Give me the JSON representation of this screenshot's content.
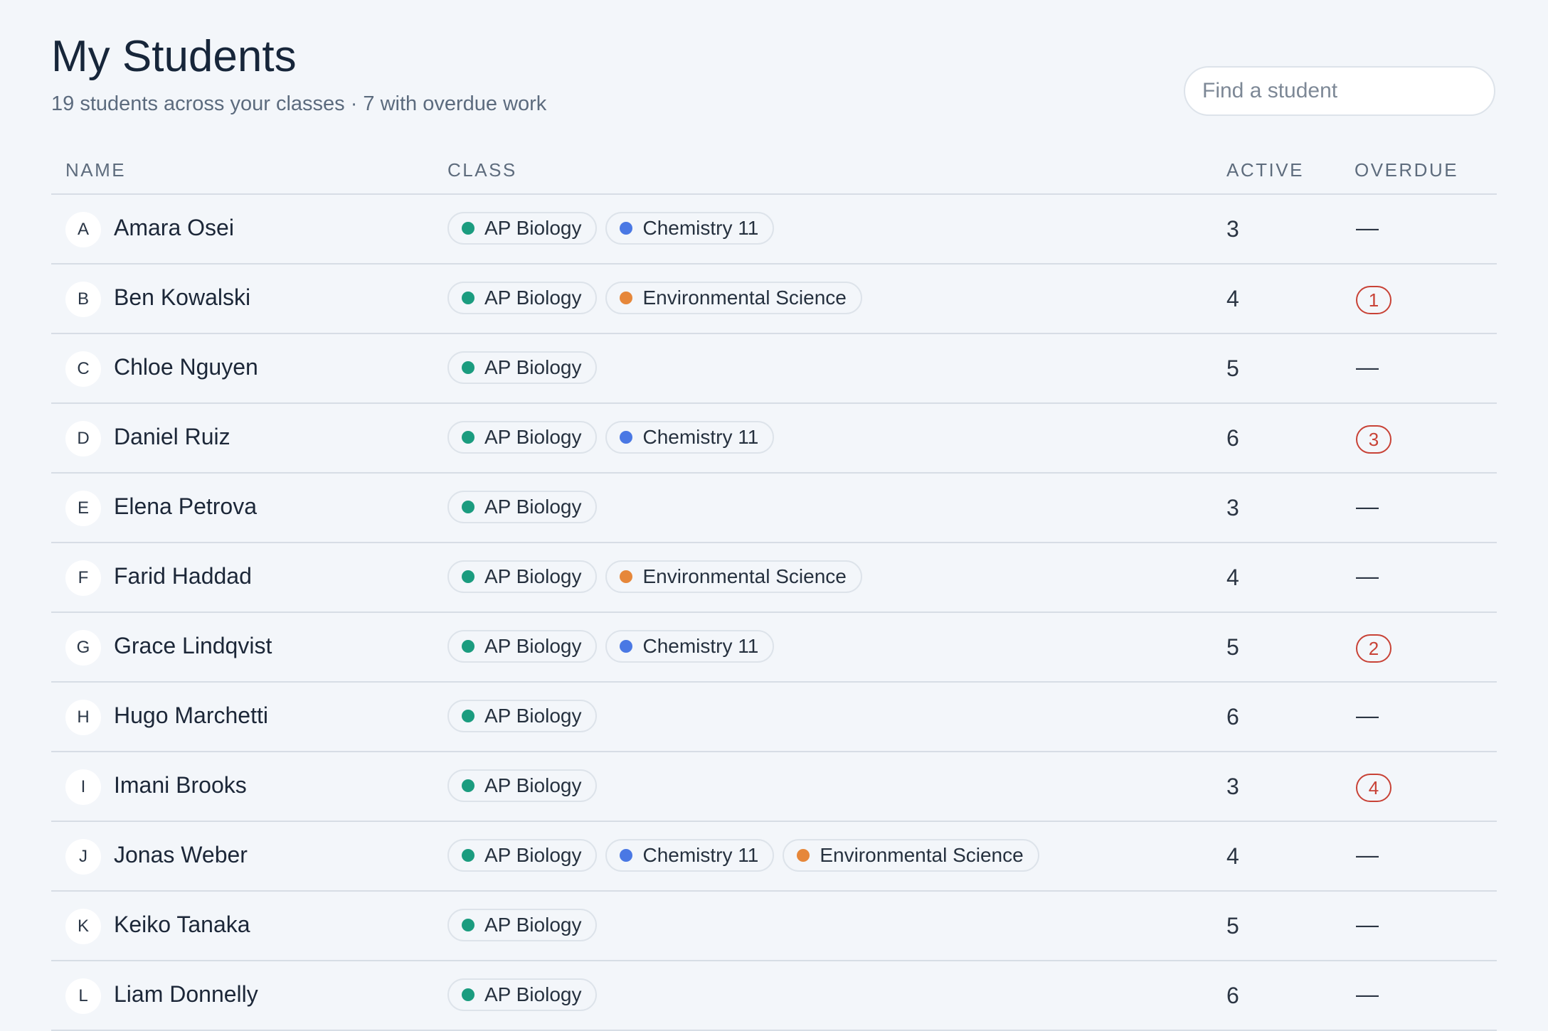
{
  "header": {
    "title": "My Students",
    "subtitle": "19 students across your classes · 7 with overdue work",
    "search_placeholder": "Find a student"
  },
  "colors": {
    "AP Biology": "#1b9c7f",
    "Chemistry 11": "#4a78e4",
    "Environmental Science": "#e6873a",
    "overdue_badge": "#c84236"
  },
  "columns": [
    "NAME",
    "CLASS",
    "ACTIVE",
    "OVERDUE"
  ],
  "students": [
    {
      "initial": "A",
      "name": "Amara Osei",
      "classes": [
        "AP Biology",
        "Chemistry 11"
      ],
      "active": "3",
      "overdue": "—"
    },
    {
      "initial": "B",
      "name": "Ben Kowalski",
      "classes": [
        "AP Biology",
        "Environmental Science"
      ],
      "active": "4",
      "overdue": "1"
    },
    {
      "initial": "C",
      "name": "Chloe Nguyen",
      "classes": [
        "AP Biology"
      ],
      "active": "5",
      "overdue": "—"
    },
    {
      "initial": "D",
      "name": "Daniel Ruiz",
      "classes": [
        "AP Biology",
        "Chemistry 11"
      ],
      "active": "6",
      "overdue": "3"
    },
    {
      "initial": "E",
      "name": "Elena Petrova",
      "classes": [
        "AP Biology"
      ],
      "active": "3",
      "overdue": "—"
    },
    {
      "initial": "F",
      "name": "Farid Haddad",
      "classes": [
        "AP Biology",
        "Environmental Science"
      ],
      "active": "4",
      "overdue": "—"
    },
    {
      "initial": "G",
      "name": "Grace Lindqvist",
      "classes": [
        "AP Biology",
        "Chemistry 11"
      ],
      "active": "5",
      "overdue": "2"
    },
    {
      "initial": "H",
      "name": "Hugo Marchetti",
      "classes": [
        "AP Biology"
      ],
      "active": "6",
      "overdue": "—"
    },
    {
      "initial": "I",
      "name": "Imani Brooks",
      "classes": [
        "AP Biology"
      ],
      "active": "3",
      "overdue": "4"
    },
    {
      "initial": "J",
      "name": "Jonas Weber",
      "classes": [
        "AP Biology",
        "Chemistry 11",
        "Environmental Science"
      ],
      "active": "4",
      "overdue": "—"
    },
    {
      "initial": "K",
      "name": "Keiko Tanaka",
      "classes": [
        "AP Biology"
      ],
      "active": "5",
      "overdue": "—"
    },
    {
      "initial": "L",
      "name": "Liam Donnelly",
      "classes": [
        "AP Biology"
      ],
      "active": "6",
      "overdue": "—"
    }
  ]
}
